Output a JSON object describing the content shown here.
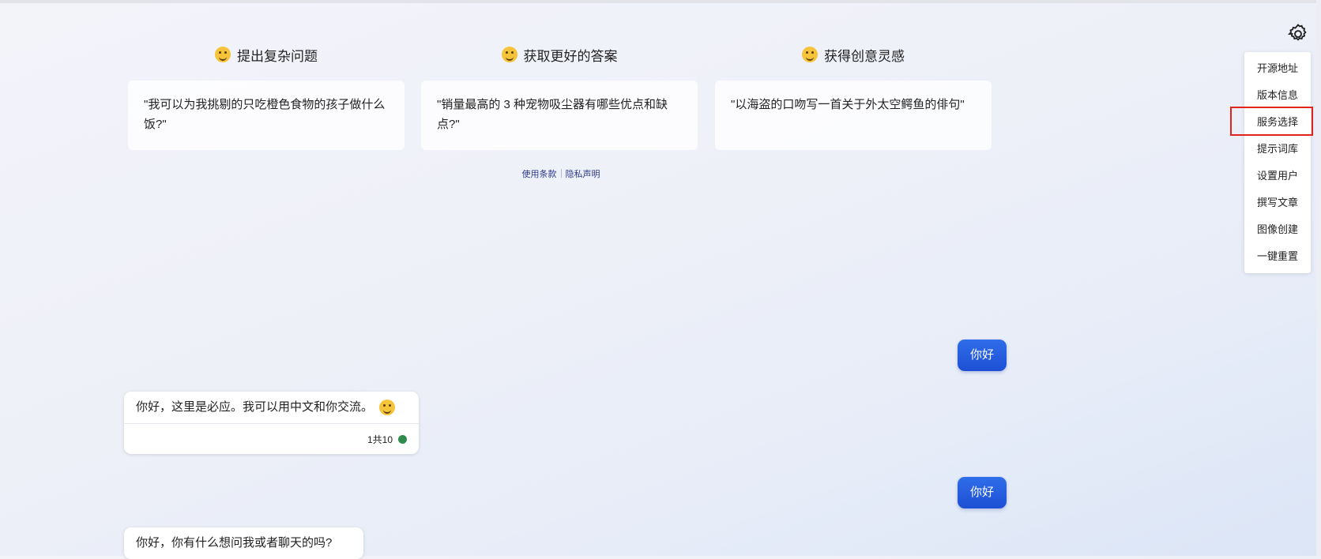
{
  "intro": {
    "columns": [
      {
        "title": "提出复杂问题",
        "example": "\"我可以为我挑剔的只吃橙色食物的孩子做什么饭?\"",
        "icon": "thinking-face-icon"
      },
      {
        "title": "获取更好的答案",
        "example": "\"销量最高的 3 种宠物吸尘器有哪些优点和缺点?\"",
        "icon": "hands-face-icon"
      },
      {
        "title": "获得创意灵感",
        "example": "\"以海盗的口吻写一首关于外太空鳄鱼的俳句\"",
        "icon": "palette-icon"
      }
    ],
    "links": {
      "terms": "使用条款",
      "privacy": "隐私声明"
    }
  },
  "settings": {
    "icon": "gear-icon",
    "menu": [
      "开源地址",
      "版本信息",
      "服务选择",
      "提示词库",
      "设置用户",
      "撰写文章",
      "图像创建",
      "一键重置"
    ],
    "highlighted": "服务选择",
    "highlight_color": "#e2231a"
  },
  "chat": {
    "messages": [
      {
        "role": "user",
        "text": "你好"
      },
      {
        "role": "bot",
        "text": "你好，这里是必应。我可以用中文和你交流。",
        "count": "1共10",
        "status_color": "#2f8a4e"
      },
      {
        "role": "user",
        "text": "你好"
      },
      {
        "role": "bot",
        "text": "你好，你有什么想问我或者聊天的吗?"
      }
    ]
  },
  "colors": {
    "accent": "#1e4fd6",
    "link": "#2c3a8a"
  }
}
